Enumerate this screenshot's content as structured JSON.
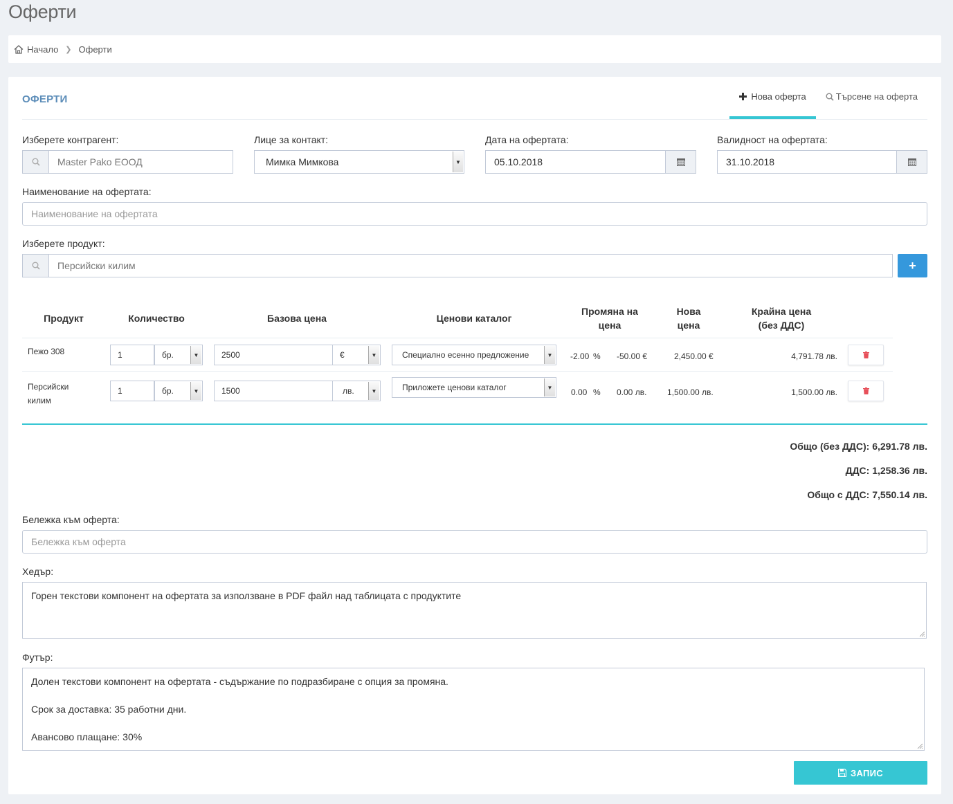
{
  "page": {
    "title": "Оферти"
  },
  "breadcrumb": {
    "home": "Начало",
    "current": "Оферти"
  },
  "panel": {
    "title": "ОФЕРТИ",
    "tabs": [
      {
        "label": "Нова оферта",
        "icon": "plus-icon",
        "active": true
      },
      {
        "label": "Търсене на оферта",
        "icon": "search-icon",
        "active": false
      }
    ]
  },
  "form": {
    "contractor": {
      "label": "Изберете контрагент:",
      "value": "Master Pako ЕООД"
    },
    "contact": {
      "label": "Лице за контакт:",
      "value": "Мимка Мимкова"
    },
    "offer_date": {
      "label": "Дата на офертата:",
      "value": "05.10.2018"
    },
    "validity": {
      "label": "Валидност на офертата:",
      "value": "31.10.2018"
    },
    "offer_name": {
      "label": "Наименование на офертата:",
      "placeholder": "Наименование на офертата"
    },
    "product": {
      "label": "Изберете продукт:",
      "value": "Персийски килим",
      "add_label": "+"
    }
  },
  "table": {
    "headers": {
      "product": "Продукт",
      "quantity": "Количество",
      "base_price": "Базова цена",
      "catalog": "Ценови каталог",
      "change_l1": "Промяна на",
      "change_l2": "цена",
      "new_l1": "Нова",
      "new_l2": "цена",
      "final_l1": "Крайна цена",
      "final_l2": "(без ДДС)"
    },
    "rows": [
      {
        "name_l1": "Пежо 308",
        "name_l2": "",
        "qty": "1",
        "unit": "бр.",
        "price": "2500",
        "currency": "€",
        "catalog": "Специално есенно предложение",
        "change_pct": "-2.00",
        "pct_sign": "%",
        "change_amount": "-50.00 €",
        "new_price": "2,450.00 €",
        "final_price": "4,791.78 лв."
      },
      {
        "name_l1": "Персийски",
        "name_l2": "килим",
        "qty": "1",
        "unit": "бр.",
        "price": "1500",
        "currency": "лв.",
        "catalog": "Приложете ценови каталог",
        "change_pct": "0.00",
        "pct_sign": "%",
        "change_amount": "0.00 лв.",
        "new_price": "1,500.00 лв.",
        "final_price": "1,500.00 лв."
      }
    ]
  },
  "totals": {
    "subtotal": "Общо  (без ДДС): 6,291.78 лв.",
    "vat": "ДДС: 1,258.36 лв.",
    "total": "Общо с ДДС: 7,550.14 лв."
  },
  "note": {
    "label": "Бележка към оферта:",
    "placeholder": "Бележка към оферта"
  },
  "header": {
    "label": "Хедър:",
    "value": "Горен текстови компонент на офертата за използване в PDF файл над таблицата с продуктите"
  },
  "footer": {
    "label": "Футър:",
    "line1": "Долен текстови компонент на офертата - съдържание по подразбиране с опция за промяна.",
    "line2": "Срок за доставка: 35 работни дни.",
    "line3": "Авансово плащане: 30%"
  },
  "save": {
    "label": "ЗАПИС"
  },
  "colors": {
    "accent": "#36c6d3",
    "primary": "#3598dc",
    "title": "#5b8cb8",
    "danger": "#e7505a"
  }
}
